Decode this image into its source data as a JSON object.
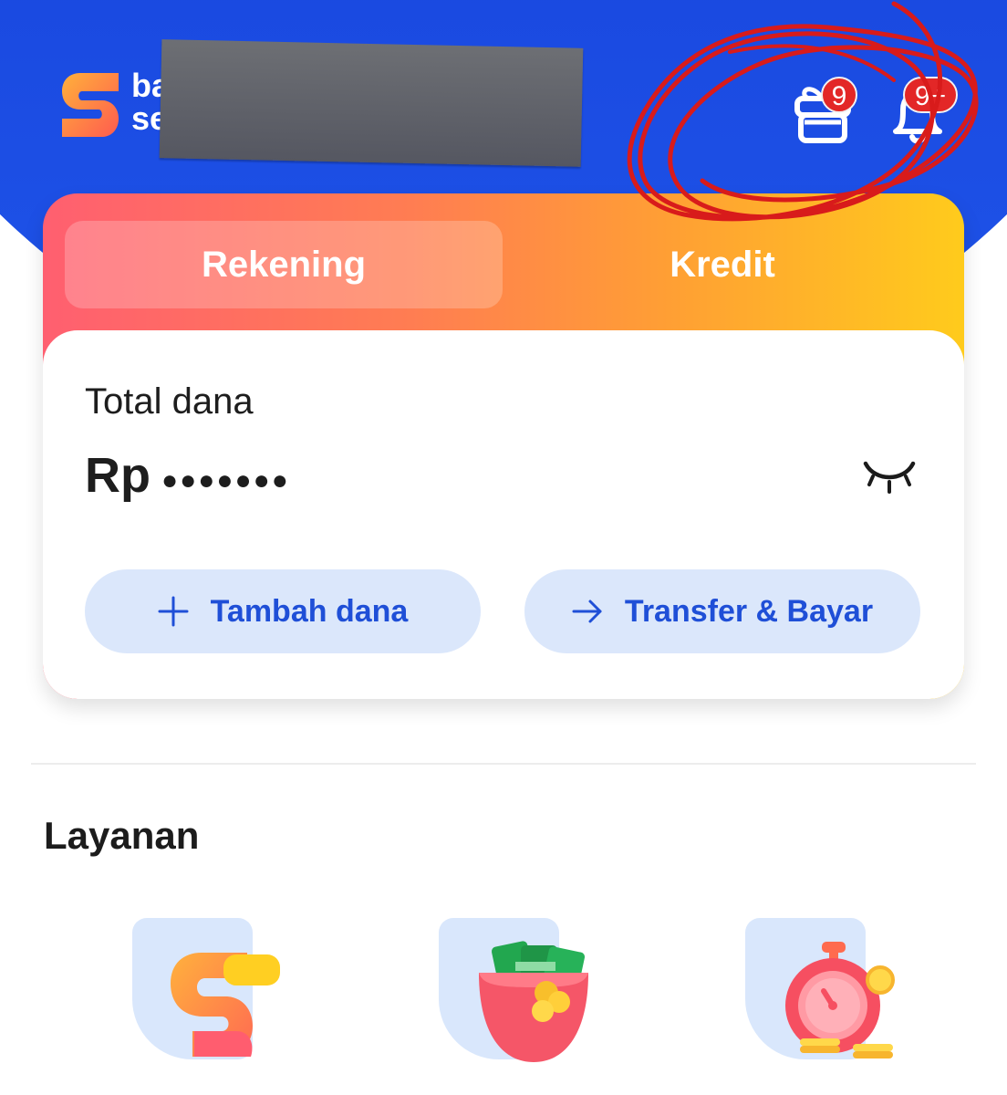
{
  "header": {
    "brand_line1": "ba",
    "brand_line2": "se",
    "gift_badge": "9",
    "notification_badge": "9+"
  },
  "account_card": {
    "tabs": [
      {
        "label": "Rekening",
        "active": true
      },
      {
        "label": "Kredit",
        "active": false
      }
    ],
    "total_label": "Total dana",
    "currency": "Rp",
    "masked_value": "●●●●●●●",
    "actions": [
      {
        "label": "Tambah dana",
        "icon": "plus-icon"
      },
      {
        "label": "Transfer & Bayar",
        "icon": "arrow-right-icon"
      }
    ]
  },
  "services": {
    "title": "Layanan",
    "items": [
      {
        "label": "",
        "icon": "brand-s-3d-icon"
      },
      {
        "label": "",
        "icon": "money-wallet-icon"
      },
      {
        "label": "",
        "icon": "timer-coins-icon"
      }
    ]
  },
  "colors": {
    "brand_blue": "#1f4fd7",
    "header_blue": "#1f46d8",
    "gradient_start": "#ff5f70",
    "gradient_end": "#ffcb1c",
    "button_bg": "#dbe7fb",
    "badge_red": "#e32727",
    "scribble_red": "#d81b1b"
  }
}
